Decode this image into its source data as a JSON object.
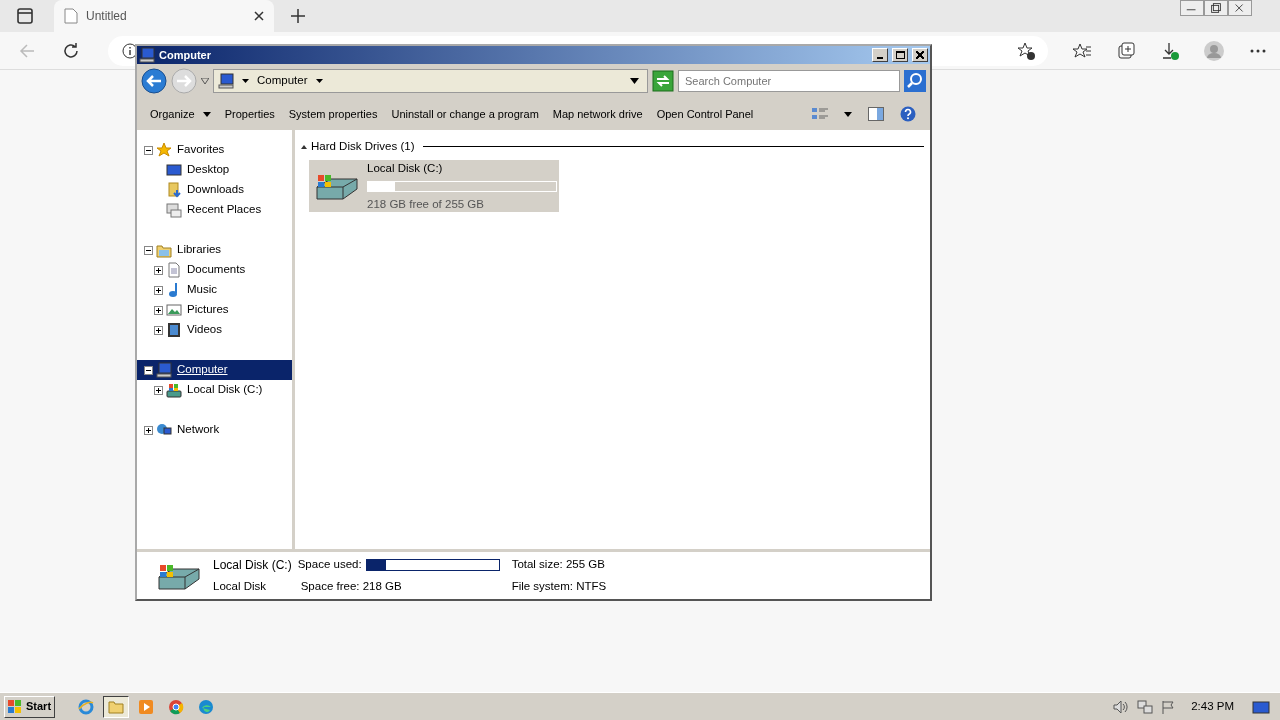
{
  "browser": {
    "tab_title": "Untitled"
  },
  "window": {
    "title": "Computer",
    "breadcrumb": "Computer",
    "search": {
      "placeholder": "Search Computer"
    }
  },
  "toolbar": [
    {
      "label": "Organize",
      "menu": true
    },
    {
      "label": "Properties",
      "menu": false
    },
    {
      "label": "System properties",
      "menu": false
    },
    {
      "label": "Uninstall or change a program",
      "menu": false
    },
    {
      "label": "Map network drive",
      "menu": false
    },
    {
      "label": "Open Control Panel",
      "menu": false
    }
  ],
  "navigation": [
    {
      "label": "Favorites",
      "expanded": true,
      "selected": false,
      "children": [
        {
          "label": "Desktop",
          "selected": false
        },
        {
          "label": "Downloads",
          "selected": false
        },
        {
          "label": "Recent Places",
          "selected": false
        }
      ]
    },
    {
      "label": "Libraries",
      "expanded": true,
      "selected": false,
      "children": [
        {
          "label": "Documents",
          "expanded": false,
          "selected": false
        },
        {
          "label": "Music",
          "expanded": false,
          "selected": false
        },
        {
          "label": "Pictures",
          "expanded": false,
          "selected": false
        },
        {
          "label": "Videos",
          "expanded": false,
          "selected": false
        }
      ]
    },
    {
      "label": "Computer",
      "expanded": true,
      "selected": true,
      "children": [
        {
          "label": "Local Disk (C:)",
          "expanded": false,
          "selected": false
        }
      ]
    },
    {
      "label": "Network",
      "expanded": false,
      "selected": false
    }
  ],
  "content": {
    "group": "Hard Disk Drives (1)",
    "drives": [
      {
        "name": "Local Disk (C:)",
        "level": 0.145,
        "free_text": "218 GB free of 255 GB",
        "selected": true
      }
    ]
  },
  "details": {
    "name": "Local Disk (C:)",
    "type": "Local Disk",
    "level": 0.145,
    "fields": [
      {
        "label": "Space used:"
      },
      {
        "label": "Space free:",
        "value": "218 GB"
      },
      {
        "label": "Total size:",
        "value": "255 GB"
      },
      {
        "label": "File system:",
        "value": "NTFS"
      }
    ]
  },
  "taskbar": {
    "start": "Start",
    "apps": [
      {
        "kind": "ie",
        "active": false
      },
      {
        "kind": "explorer",
        "active": true
      },
      {
        "kind": "media",
        "active": false
      },
      {
        "kind": "chrome",
        "active": false
      },
      {
        "kind": "edge",
        "active": false
      }
    ],
    "clock": "2:43 PM"
  }
}
